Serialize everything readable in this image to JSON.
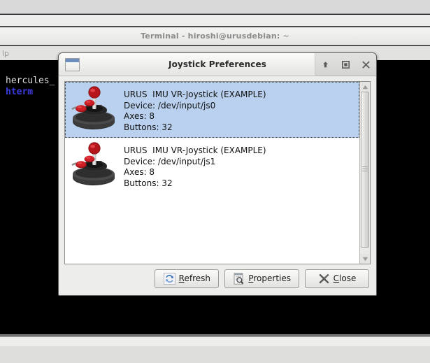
{
  "desktop": {
    "terminal": {
      "title": "Terminal - hiroshi@urusdebian: ~",
      "menu_item": "lp",
      "lines": [
        {
          "text": "hercules_",
          "color": "#dcdcdc"
        },
        {
          "text": "hterm",
          "color": "#3b3bdd"
        }
      ]
    }
  },
  "dialog": {
    "title": "Joystick Preferences",
    "window_icon": "window-icon",
    "controls": [
      {
        "name": "shade-button",
        "icon": "up-arrow-icon"
      },
      {
        "name": "maximize-button",
        "icon": "maximize-square-icon"
      },
      {
        "name": "close-button",
        "icon": "close-x-icon"
      }
    ],
    "devices": [
      {
        "icon": "joystick-icon",
        "name": "URUS  IMU VR-Joystick (EXAMPLE)",
        "device": "Device: /dev/input/js0",
        "axes": "Axes: 8",
        "buttons": "Buttons: 32",
        "selected": true
      },
      {
        "icon": "joystick-icon",
        "name": "URUS  IMU VR-Joystick (EXAMPLE)",
        "device": "Device: /dev/input/js1",
        "axes": "Axes: 8",
        "buttons": "Buttons: 32",
        "selected": false
      }
    ],
    "scrollbar": {
      "up_arrow": "scroll-up-arrow-icon",
      "down_arrow": "scroll-down-arrow-icon"
    },
    "footer": {
      "refresh": {
        "mnemonic": "R",
        "rest": "efresh",
        "icon": "refresh-icon"
      },
      "properties": {
        "mnemonic": "P",
        "rest": "roperties",
        "icon": "properties-icon"
      },
      "close": {
        "mnemonic": "C",
        "rest": "lose",
        "icon": "close-x-icon"
      }
    }
  },
  "colors": {
    "selection": "#b9d1ef",
    "joystick_red": "#cf1f26",
    "refresh_blue": "#3a6fb5",
    "terminal_blue": "#3b3bdd"
  }
}
